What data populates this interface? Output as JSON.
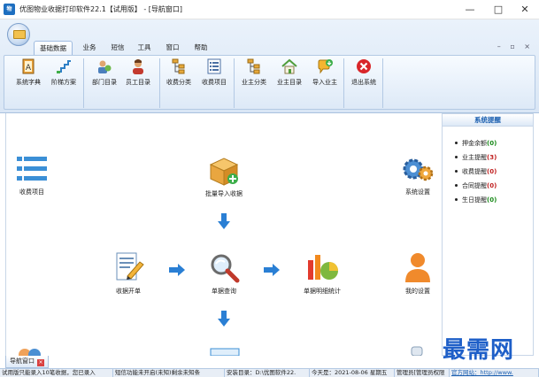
{
  "window": {
    "title": "优图物业收据打印软件22.1【试用版】 - [导航窗口]",
    "app_icon_text": "物",
    "controls": {
      "minimize": "—",
      "maximize": "□",
      "close": "✕"
    }
  },
  "ribbon": {
    "tabs": [
      {
        "label": "基础数据",
        "active": true
      },
      {
        "label": "业务",
        "active": false
      },
      {
        "label": "短信",
        "active": false
      },
      {
        "label": "工具",
        "active": false
      },
      {
        "label": "窗口",
        "active": false
      },
      {
        "label": "帮助",
        "active": false
      }
    ],
    "window_controls": "– ▫ ×",
    "buttons": [
      {
        "label": "系统字典",
        "icon": "dictionary-icon"
      },
      {
        "label": "阶梯方案",
        "icon": "steps-icon"
      },
      {
        "label": "部门目录",
        "icon": "department-icon"
      },
      {
        "label": "员工目录",
        "icon": "employee-icon"
      },
      {
        "label": "收费分类",
        "icon": "fee-category-icon"
      },
      {
        "label": "收费项目",
        "icon": "fee-item-icon"
      },
      {
        "label": "业主分类",
        "icon": "owner-category-icon"
      },
      {
        "label": "业主目录",
        "icon": "owner-directory-icon"
      },
      {
        "label": "导入业主",
        "icon": "import-owner-icon"
      },
      {
        "label": "退出系统",
        "icon": "exit-icon"
      }
    ]
  },
  "workspace": {
    "nodes": [
      {
        "label": "收费项目",
        "icon": "fee-list-icon"
      },
      {
        "label": "批量导入收据",
        "icon": "box-import-icon"
      },
      {
        "label": "系统设置",
        "icon": "gears-icon"
      },
      {
        "label": "收据开单",
        "icon": "receipt-edit-icon"
      },
      {
        "label": "单据查询",
        "icon": "magnifier-icon"
      },
      {
        "label": "单据明细统计",
        "icon": "statistics-icon"
      },
      {
        "label": "我的设置",
        "icon": "person-icon"
      }
    ]
  },
  "reminders": {
    "title": "系统提醒",
    "items": [
      {
        "label": "押金余额",
        "count": "(0)",
        "color": "#1a8a1a"
      },
      {
        "label": "业主提醒",
        "count": "(3)",
        "color": "#c02020"
      },
      {
        "label": "收费提醒",
        "count": "(0)",
        "color": "#c02020"
      },
      {
        "label": "合同提醒",
        "count": "(0)",
        "color": "#c02020"
      },
      {
        "label": "生日提醒",
        "count": "(0)",
        "color": "#1a8a1a"
      }
    ]
  },
  "nav_tab": {
    "label": "导航窗口",
    "close": "×"
  },
  "status": {
    "segments": [
      "试用版只能录入10笔收据，您已录入",
      "短信功能未开启(未知)剩余未知条",
      "安装目录：D:\\优图软件22.",
      "今天是：2021-08-06 星期五",
      "管理员[管理员权限",
      "官方网站：http://www."
    ]
  },
  "watermark": "最需网"
}
